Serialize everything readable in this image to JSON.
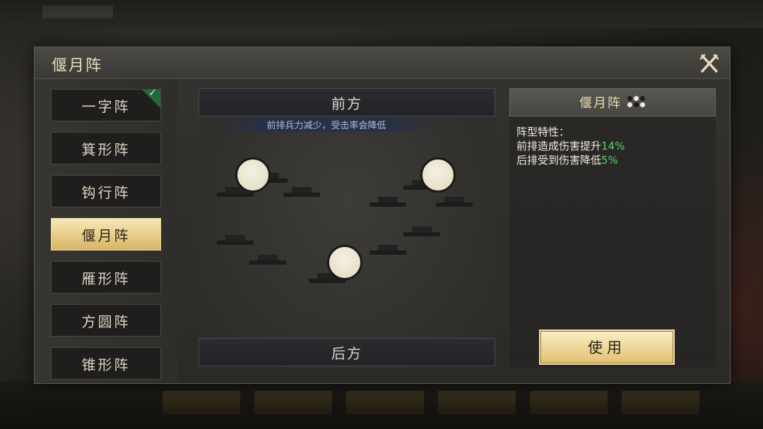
{
  "dialog": {
    "title": "偃月阵"
  },
  "formations": [
    {
      "label": "一字阵",
      "equipped": true,
      "selected": false
    },
    {
      "label": "箕形阵",
      "equipped": false,
      "selected": false
    },
    {
      "label": "钩行阵",
      "equipped": false,
      "selected": false
    },
    {
      "label": "偃月阵",
      "equipped": false,
      "selected": true
    },
    {
      "label": "雁形阵",
      "equipped": false,
      "selected": false
    },
    {
      "label": "方圆阵",
      "equipped": false,
      "selected": false
    },
    {
      "label": "锥形阵",
      "equipped": false,
      "selected": false
    }
  ],
  "board": {
    "front_label": "前方",
    "front_note": "前排兵力减少，受击率会降低",
    "rear_label": "后方"
  },
  "info": {
    "header_title": "偃月阵",
    "traits_title": "阵型特性：",
    "trait1_text": "前排造成伤害提升",
    "trait1_value": "14%",
    "trait2_text": "后排受到伤害降低",
    "trait2_value": "5%",
    "use_label": "使用"
  },
  "icons": {
    "close": "close-x-icon",
    "equipped": "check-icon",
    "formation_dots": "formation-dots-icon"
  },
  "colors": {
    "accent_gold": "#e6c982",
    "positive_green": "#58d26a",
    "equipped_green": "#1f6b3a"
  }
}
